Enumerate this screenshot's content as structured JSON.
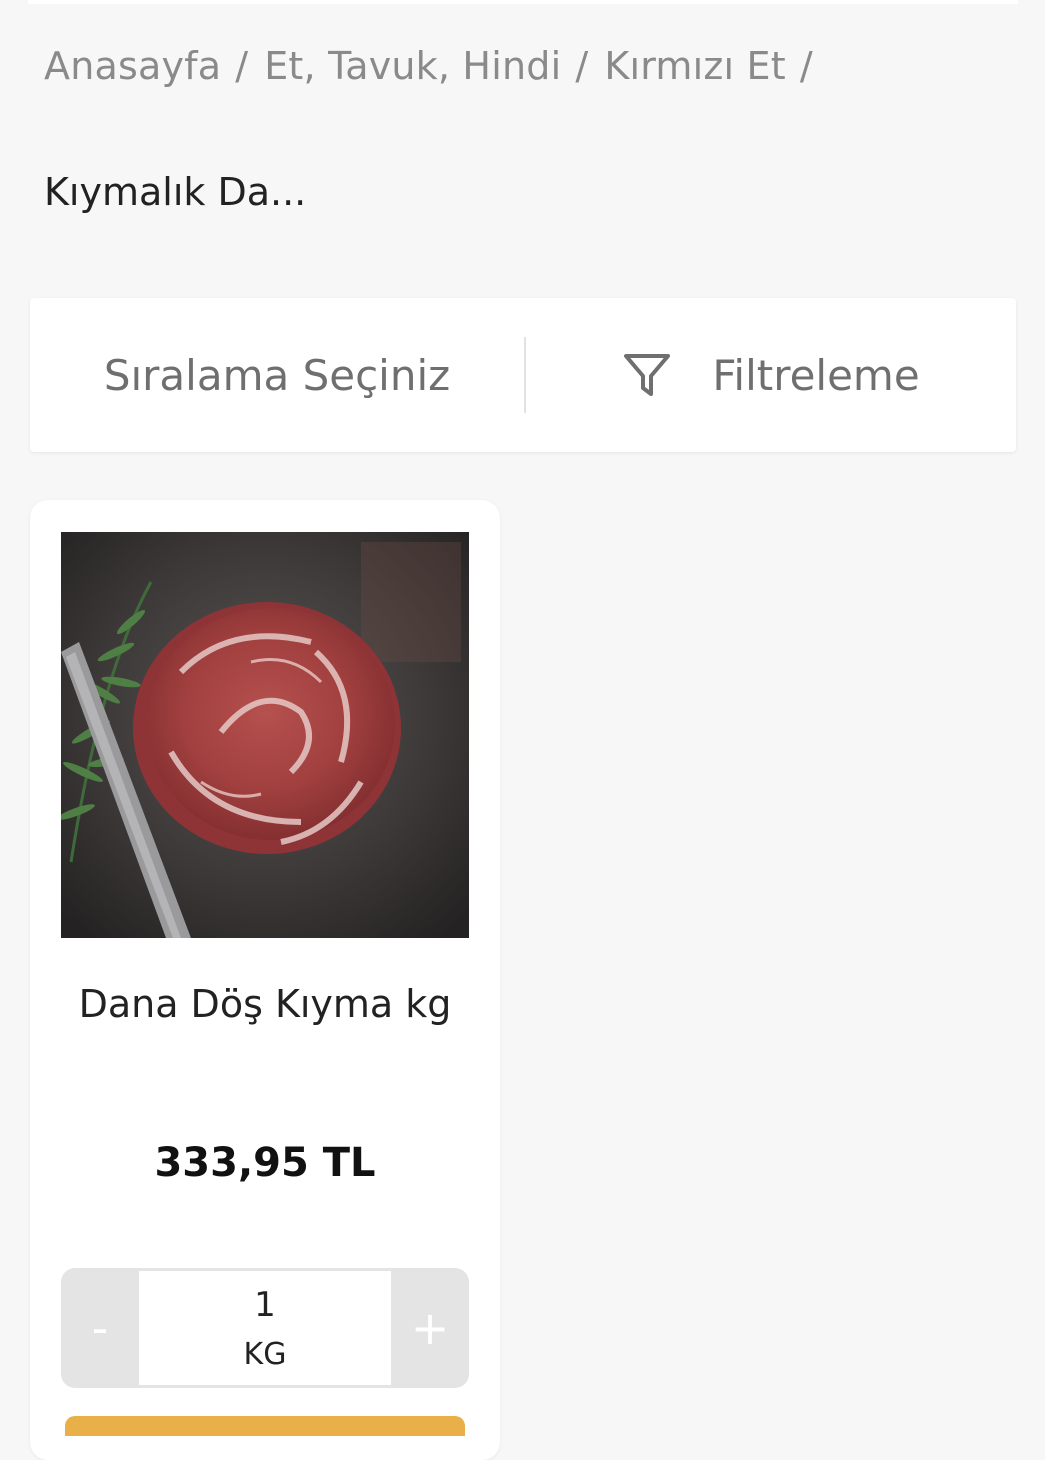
{
  "breadcrumb": {
    "items": [
      "Anasayfa",
      "Et, Tavuk, Hindi",
      "Kırmızı Et"
    ],
    "separator": "/"
  },
  "current_page": "Kıymalık Da...",
  "toolbar": {
    "sort_label": "Sıralama Seçiniz",
    "filter_label": "Filtreleme",
    "filter_icon": "filter-funnel-icon"
  },
  "product": {
    "name": "Dana Döş Kıyma kg",
    "price": "333,95 TL",
    "quantity": "1",
    "unit": "KG",
    "decrement_label": "-",
    "increment_label": "+"
  },
  "colors": {
    "background": "#f7f7f7",
    "card": "#ffffff",
    "stepper": "#e4e4e4",
    "add_button": "#e9b04a"
  }
}
